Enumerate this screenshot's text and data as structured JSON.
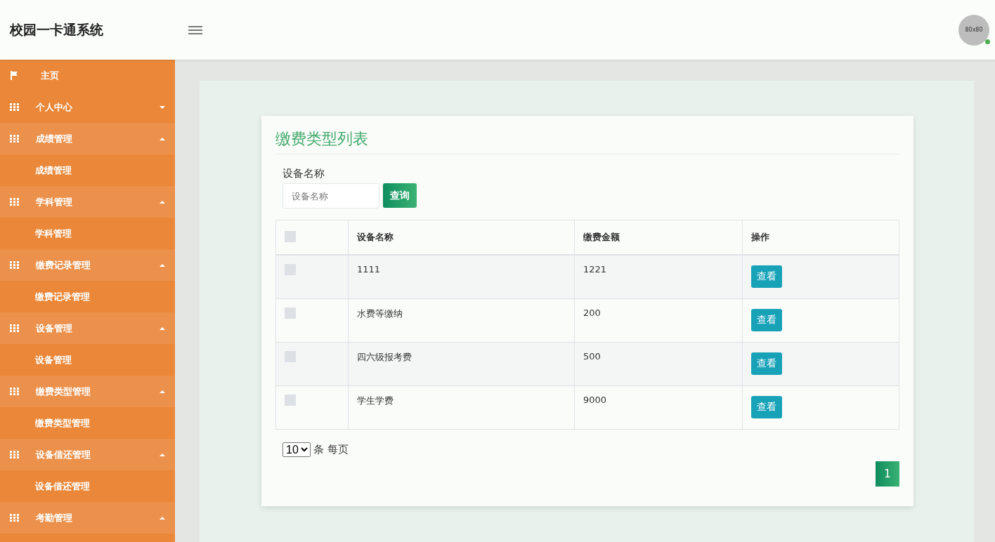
{
  "header": {
    "title": "校园一卡通系统",
    "avatar": {
      "text": "80x80",
      "online": true
    }
  },
  "sidebar": {
    "items": [
      {
        "kind": "home",
        "label": "主页",
        "expanded": false
      },
      {
        "kind": "group",
        "label": "个人中心",
        "expanded": false
      },
      {
        "kind": "group",
        "label": "成绩管理",
        "expanded": true,
        "children": [
          {
            "label": "成绩管理"
          }
        ]
      },
      {
        "kind": "group",
        "label": "学科管理",
        "expanded": true,
        "children": [
          {
            "label": "学科管理"
          }
        ]
      },
      {
        "kind": "group",
        "label": "缴费记录管理",
        "expanded": true,
        "children": [
          {
            "label": "缴费记录管理"
          }
        ]
      },
      {
        "kind": "group",
        "label": "设备管理",
        "expanded": true,
        "children": [
          {
            "label": "设备管理"
          }
        ]
      },
      {
        "kind": "group",
        "label": "缴费类型管理",
        "expanded": true,
        "children": [
          {
            "label": "缴费类型管理"
          }
        ]
      },
      {
        "kind": "group",
        "label": "设备借还管理",
        "expanded": true,
        "children": [
          {
            "label": "设备借还管理"
          }
        ]
      },
      {
        "kind": "group",
        "label": "考勤管理",
        "expanded": true
      }
    ]
  },
  "card": {
    "title": "缴费类型列表",
    "search": {
      "label": "设备名称",
      "placeholder": "设备名称",
      "button": "查询"
    },
    "table": {
      "header_checked": false,
      "columns": [
        "设备名称",
        "缴费金额",
        "操作"
      ],
      "rows": [
        {
          "checked": false,
          "name": "1111",
          "amount": "1221",
          "action": "查看"
        },
        {
          "checked": false,
          "name": "水费等缴纳",
          "amount": "200",
          "action": "查看"
        },
        {
          "checked": false,
          "name": "四六级报考费",
          "amount": "500",
          "action": "查看"
        },
        {
          "checked": false,
          "name": "学生学费",
          "amount": "9000",
          "action": "查看"
        }
      ]
    },
    "page_size": {
      "value": "10",
      "label": "条 每页"
    },
    "pages": [
      {
        "label": "1",
        "selected": true
      }
    ]
  }
}
